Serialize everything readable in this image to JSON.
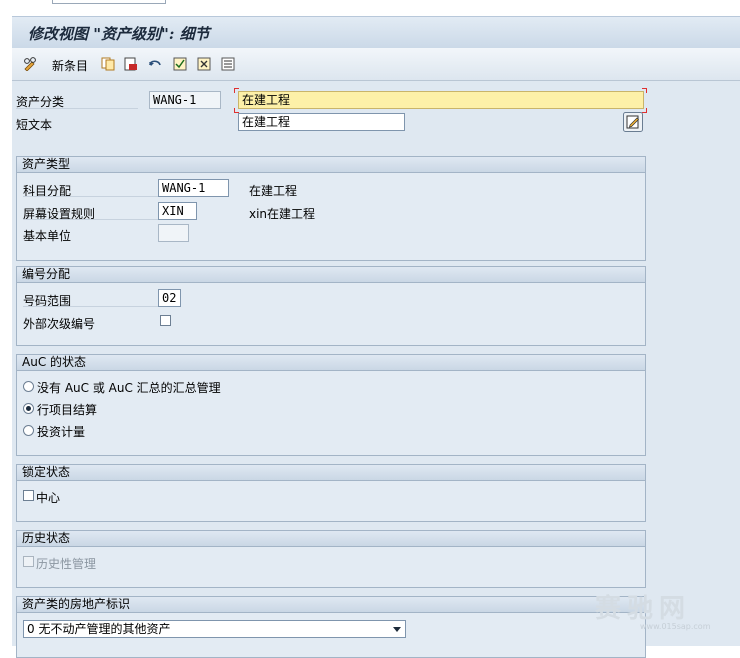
{
  "window": {
    "title": "修改视图 \"资产级别\": 细节"
  },
  "toolbar": {
    "new_entries_label": "新条目",
    "icons": [
      "glasses-edit-icon",
      "copy-icon",
      "delete-icon",
      "undo-icon",
      "select-all-icon",
      "deselect-all-icon",
      "select-block-icon"
    ]
  },
  "header": {
    "asset_class_label": "资产分类",
    "asset_class_value": "WANG-1",
    "asset_class_desc": "在建工程",
    "short_text_label": "短文本",
    "short_text_value": "在建工程"
  },
  "asset_type": {
    "title": "资产类型",
    "account_det_label": "科目分配",
    "account_det_value": "WANG-1",
    "account_det_desc": "在建工程",
    "screen_layout_label": "屏幕设置规则",
    "screen_layout_value": "XIN",
    "screen_layout_desc": "xin在建工程",
    "base_unit_label": "基本单位",
    "base_unit_value": ""
  },
  "number_assignment": {
    "title": "编号分配",
    "number_range_label": "号码范围",
    "number_range_value": "02",
    "ext_sub_number_label": "外部次级编号",
    "ext_sub_number_checked": false
  },
  "auc_status": {
    "title": "AuC 的状态",
    "options": [
      {
        "label": "没有 AuC 或 AuC 汇总的汇总管理",
        "selected": false
      },
      {
        "label": "行项目结算",
        "selected": true
      },
      {
        "label": "投资计量",
        "selected": false
      }
    ]
  },
  "lock_status": {
    "title": "锁定状态",
    "center_label": "中心",
    "center_checked": false
  },
  "history_status": {
    "title": "历史状态",
    "history_mgmt_label": "历史性管理",
    "history_mgmt_checked": false,
    "history_mgmt_enabled": false
  },
  "real_estate": {
    "title": "资产类的房地产标识",
    "selected_option": "0 无不动产管理的其他资产"
  },
  "watermark": {
    "text": "赛驰网",
    "url": "www.015sap.com"
  }
}
